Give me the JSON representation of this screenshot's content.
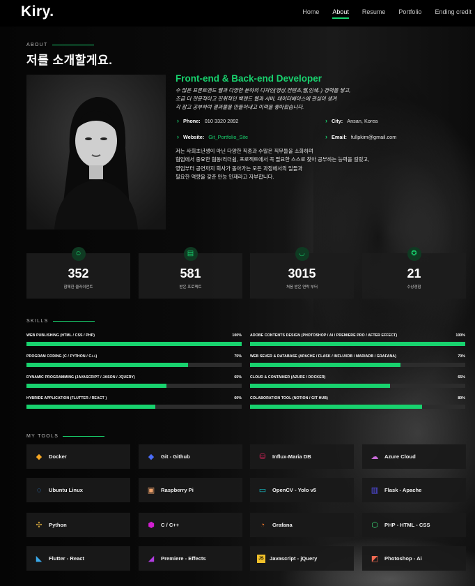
{
  "header": {
    "logo": "Kiry.",
    "nav": [
      "Home",
      "About",
      "Resume",
      "Portfolio",
      "Ending credit"
    ],
    "active": "About"
  },
  "about": {
    "section_label": "ABOUT",
    "heading": "저를 소개할게요.",
    "role": "Front-end & Back-end Developer",
    "intro": [
      "수 많은 프론트엔드 웹과 다양한 분야의 디자인(영상,컨텐츠,웹,인쇄..) 경력을 쌓고,",
      "조금 더 전문적이고 진취적인 백엔드 웹과 서버, 데이터베이스에 관심이 생겨",
      "각 잡고 공부하여 결과물을 만들어내고 이력을 쌓아왔습니다."
    ],
    "info": {
      "phone_label": "Phone:",
      "phone": "010 3320 2892",
      "city_label": "City:",
      "city": "Ansan, Korea",
      "website_label": "Website:",
      "website": "Git_Portfolio_Site",
      "email_label": "Email:",
      "email": "fullpkim@gmail.com"
    },
    "bio": [
      "저는 사회초년생이 아닌 다양한 직종과 수많은 직무들을 소화하며",
      "협업에서 중요한 협동/리더쉽, 프로젝트에서 꼭 필요한 스스로 찾아 공부하는 능력을 길렀고,",
      "영업부터 공연까지 회사가 돌아가는 모든 과정에서의 일들과",
      "필요한 역량을 갖춘 만능 인재라고 자부합니다."
    ]
  },
  "counts": [
    {
      "icon": "smile-icon",
      "glyph": "☺",
      "value": "352",
      "label": "함께한 클라이언트"
    },
    {
      "icon": "document-icon",
      "glyph": "▤",
      "value": "581",
      "label": "받은 프로젝트"
    },
    {
      "icon": "headset-icon",
      "glyph": "◡",
      "value": "3015",
      "label": "처음 받은 연락 부터"
    },
    {
      "icon": "award-icon",
      "glyph": "✪",
      "value": "21",
      "label": "수상경험"
    }
  ],
  "skills": {
    "section_label": "SKILLS",
    "items": [
      {
        "name": "WEB PUBLISHING (HTML / CSS / PHP)",
        "percent_label": "100%",
        "value": 100
      },
      {
        "name": "ADOBE CONTENTS DESIGN (PHOTOSHOP / AI / PREMIERE PRO / AFTER EFFECT)",
        "percent_label": "100%",
        "value": 100
      },
      {
        "name": "PROGRAM CODING (C / PYTHON / C++)",
        "percent_label": "75%",
        "value": 75
      },
      {
        "name": "WEB SEVER & DATABASE (APACHE / FLASK / INFLUXDB / MARIADB / GRAFANA)",
        "percent_label": "70%",
        "value": 70
      },
      {
        "name": "DYNAMIC PROGRAMMING (JAVASCRIPT / JASON / JQUERY)",
        "percent_label": "65%",
        "value": 65
      },
      {
        "name": "CLOUD & CONTAINER (AZURE / DOCKER)",
        "percent_label": "65%",
        "value": 65
      },
      {
        "name": "HYBRIDE APPLICATION (FLUTTER / REACT )",
        "percent_label": "60%",
        "value": 60
      },
      {
        "name": "COLABORATION TOOL (NOTION / GIT HUB)",
        "percent_label": "80%",
        "value": 80
      }
    ]
  },
  "tools": {
    "section_label": "MY TOOLS",
    "items": [
      {
        "label": "Docker",
        "icon": "docker-icon",
        "glyph": "◆",
        "color": "#f5a623"
      },
      {
        "label": "Git - Github",
        "icon": "git-icon",
        "glyph": "◆",
        "color": "#4a6cf7"
      },
      {
        "label": "Influx-Maria DB",
        "icon": "database-icon",
        "glyph": "⛁",
        "color": "#e0245e"
      },
      {
        "label": "Azure Cloud",
        "icon": "cloud-icon",
        "glyph": "☁",
        "color": "#c86ad8"
      },
      {
        "label": "Ubuntu Linux",
        "icon": "ubuntu-icon",
        "glyph": "◌",
        "color": "#3a8fe6"
      },
      {
        "label": "Raspberry Pi",
        "icon": "raspberry-icon",
        "glyph": "▣",
        "color": "#f0a36b"
      },
      {
        "label": "OpenCV - Yolo v5",
        "icon": "window-icon",
        "glyph": "▭",
        "color": "#16c0c8"
      },
      {
        "label": "Flask - Apache",
        "icon": "server-icon",
        "glyph": "▥",
        "color": "#5a53ff"
      },
      {
        "label": "Python",
        "icon": "python-icon",
        "glyph": "✣",
        "color": "#c49a3a"
      },
      {
        "label": "C / C++",
        "icon": "cpp-icon",
        "glyph": "⬢",
        "color": "#d21fd1"
      },
      {
        "label": "Grafana",
        "icon": "grafana-icon",
        "glyph": "◔",
        "color": "#f0782a"
      },
      {
        "label": "PHP - HTML - CSS",
        "icon": "html5-icon",
        "glyph": "⬡",
        "color": "#3ce07a"
      },
      {
        "label": "Flutter - React",
        "icon": "flutter-icon",
        "glyph": "◣",
        "color": "#3aa8e8"
      },
      {
        "label": "Premiere - Effects",
        "icon": "premiere-icon",
        "glyph": "◢",
        "color": "#b13ce0"
      },
      {
        "label": "Javascript - jQuery",
        "icon": "javascript-icon",
        "glyph": "JS",
        "color": "#f0c02a"
      },
      {
        "label": "Photoshop - Ai",
        "icon": "photoshop-icon",
        "glyph": "◩",
        "color": "#f06a52"
      }
    ]
  },
  "colors": {
    "accent": "#18d26e",
    "background": "#000000",
    "card": "#1c1c1c"
  }
}
